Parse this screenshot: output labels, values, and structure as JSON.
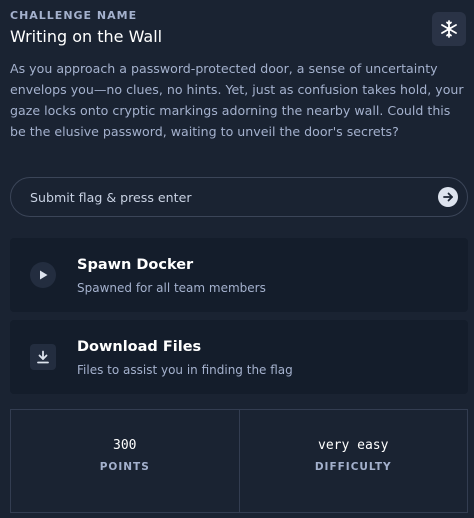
{
  "challenge": {
    "kicker": "CHALLENGE NAME",
    "name": "Writing on the Wall",
    "category_icon": "snowflake-icon",
    "description": "As you approach a password-protected door, a sense of uncertainty envelops you—no clues, no hints. Yet, just as confusion takes hold, your gaze locks onto cryptic markings adorning the nearby wall. Could this be the elusive password, waiting to unveil the door's secrets?"
  },
  "flag": {
    "placeholder": "Submit flag & press enter",
    "value": "",
    "submit_icon": "arrow-right-icon"
  },
  "actions": {
    "spawn": {
      "title": "Spawn Docker",
      "subtitle": "Spawned for all team members",
      "icon": "play-icon"
    },
    "download": {
      "title": "Download Files",
      "subtitle": "Files to assist you in finding the flag",
      "icon": "download-icon"
    }
  },
  "stats": {
    "points": {
      "value": "300",
      "label": "POINTS"
    },
    "difficulty": {
      "value": "very easy",
      "label": "DIFFICULTY"
    }
  },
  "colors": {
    "background": "#1a2332",
    "card": "#141d2b",
    "muted_text": "#a4b1cd",
    "border": "#333d51"
  }
}
